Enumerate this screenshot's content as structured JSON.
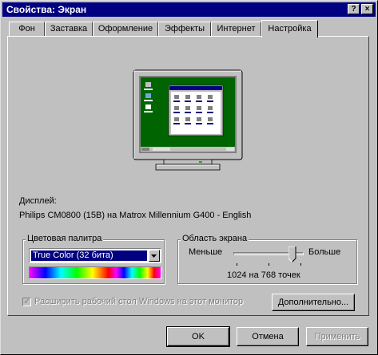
{
  "window": {
    "title": "Свойства: Экран",
    "help_button": "?",
    "close_button": "×"
  },
  "tabs": [
    {
      "label": "Фон",
      "active": false
    },
    {
      "label": "Заставка",
      "active": false
    },
    {
      "label": "Оформление",
      "active": false
    },
    {
      "label": "Эффекты",
      "active": false
    },
    {
      "label": "Интернет",
      "active": false
    },
    {
      "label": "Настройка",
      "active": true
    }
  ],
  "settings": {
    "display_label": "Дисплей:",
    "display_value": "Philips CM0800 (15B) на Matrox Millennium G400 - English",
    "color_palette": {
      "title": "Цветовая палитра",
      "selected": "True Color (32 бита)"
    },
    "screen_area": {
      "title": "Область экрана",
      "less_label": "Меньше",
      "more_label": "Больше",
      "resolution": "1024 на 768 точек",
      "slider_value": 0.88
    },
    "extend_checkbox": {
      "label": "Расширить рабочий стол Windows на этот монитор",
      "checked": true,
      "enabled": false
    },
    "advanced_button": "Дополнительно..."
  },
  "footer": {
    "ok": "OK",
    "cancel": "Отмена",
    "apply": "Применить"
  },
  "colors": {
    "title_bar": "#000080",
    "face": "#c0c0c0",
    "desktop": "#006400",
    "selection": "#000080"
  }
}
